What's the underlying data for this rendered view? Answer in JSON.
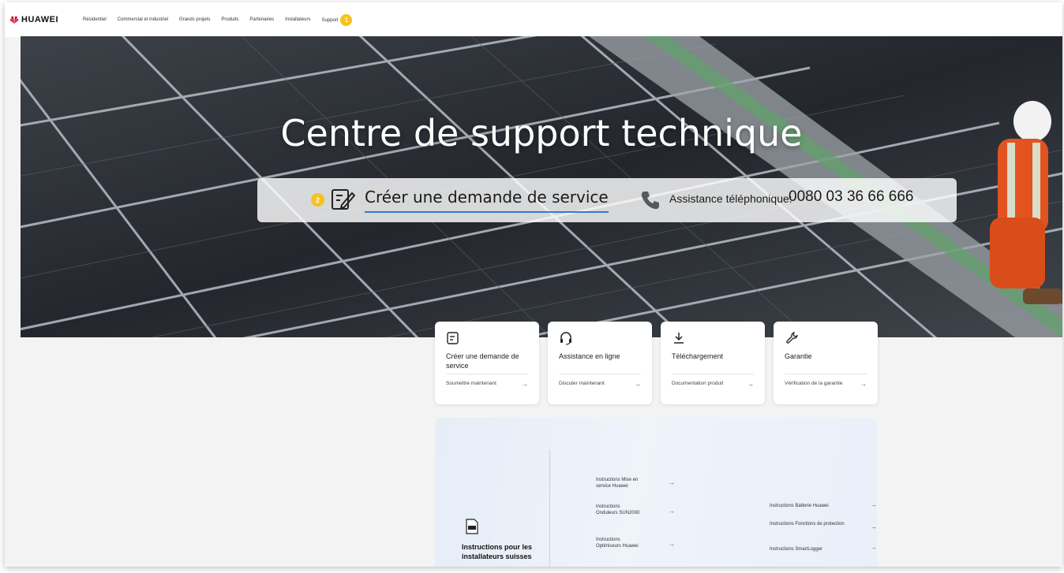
{
  "nav": {
    "brand": "HUAWEI",
    "items": [
      "Résidentiel",
      "Commercial et industriel",
      "Grands projets",
      "Produits",
      "Partenaires",
      "Installateurs",
      "Support"
    ],
    "support_badge": "1"
  },
  "hero": {
    "title": "Centre de support technique",
    "step_badge": "2",
    "request_link": "Créer une demande de service",
    "phone_label": "Assistance téléphonique:",
    "phone_number": "0080 03 36 66 666"
  },
  "cards": [
    {
      "icon": "edit-document-icon",
      "title": "Créer une demande de service",
      "action": "Soumettre maintenant"
    },
    {
      "icon": "headset-icon",
      "title": "Assistance en ligne",
      "action": "Discuter maintenant"
    },
    {
      "icon": "download-icon",
      "title": "Téléchargement",
      "action": "Documentation produit"
    },
    {
      "icon": "wrench-icon",
      "title": "Garantie",
      "action": "Vérification de la garantie"
    }
  ],
  "instructions": {
    "title": "Instructions pour les installateurs suisses",
    "left_items": [
      "Instructions Mise en service Huawei",
      "Instructions Onduleurs SUN2000",
      "Instructions Optimiseurs Huawei"
    ],
    "right_items": [
      "Instructions Batterie Huawei",
      "Instructions Fonctions de protection",
      "Instructions SmartLogger"
    ]
  },
  "colors": {
    "accent_yellow": "#f6c21b",
    "link_underline": "#2e7bd6",
    "brand_red": "#cf0a2c"
  }
}
